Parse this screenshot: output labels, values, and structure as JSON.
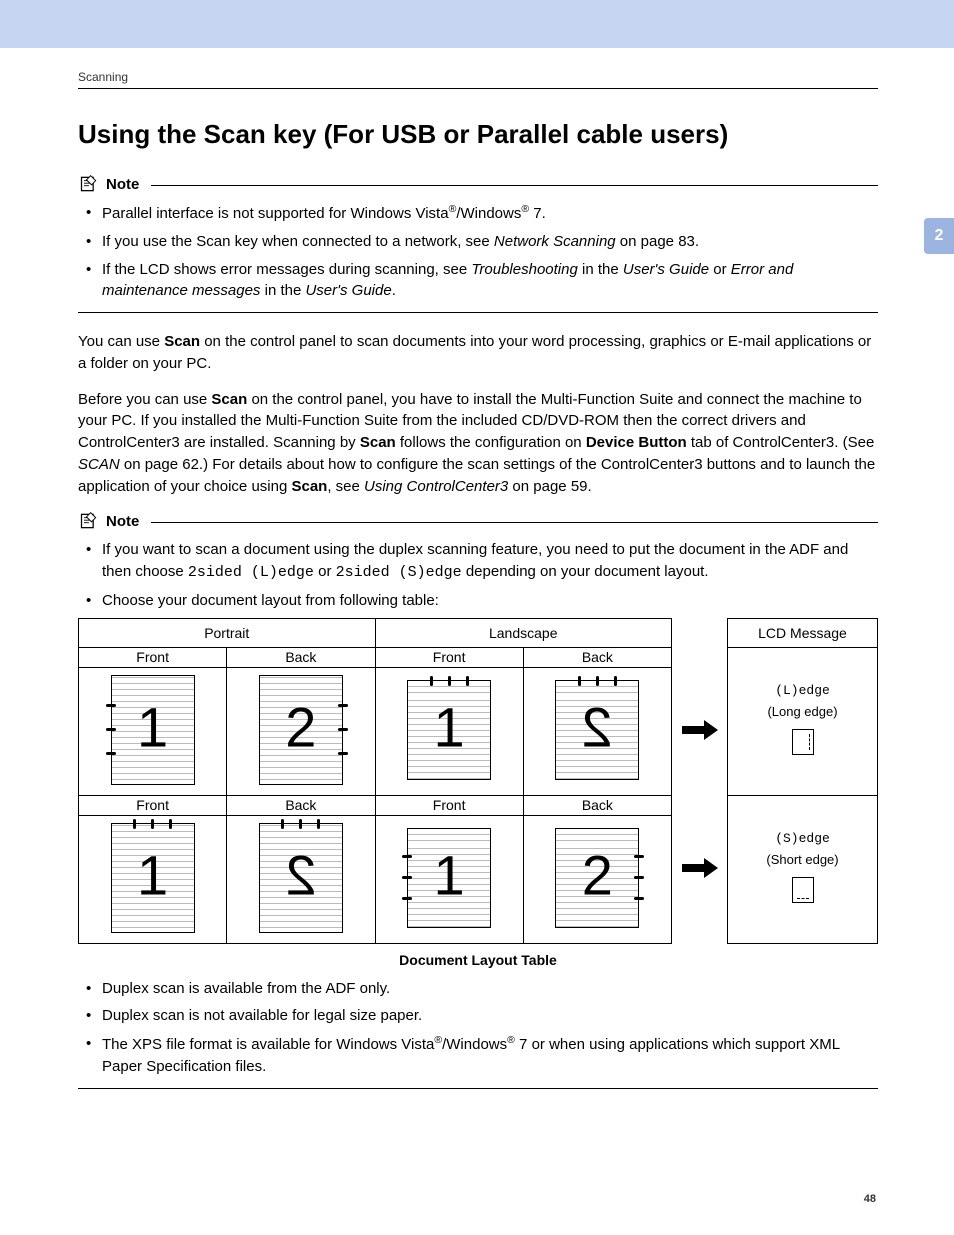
{
  "section_label": "Scanning",
  "title": "Using the Scan key (For USB or Parallel cable users)",
  "chapter_tab": "2",
  "page_number": "48",
  "note1": {
    "label": "Note",
    "bul1_pre": "Parallel interface is not supported for Windows Vista",
    "bul1_mid": "/Windows",
    "bul1_post": " 7.",
    "bul2_pre": "If you use the Scan key when connected to a network, see ",
    "bul2_link": "Network Scanning",
    "bul2_post": " on page 83.",
    "bul3_pre": "If the LCD shows error messages during scanning, see ",
    "bul3_i1": "Troubleshooting",
    "bul3_mid1": " in the ",
    "bul3_i2": "User's Guide",
    "bul3_mid2": " or ",
    "bul3_i3": "Error and maintenance messages",
    "bul3_mid3": " in the ",
    "bul3_i4": "User's Guide",
    "bul3_post": "."
  },
  "para1_a": "You can use ",
  "para1_b": "Scan",
  "para1_c": " on the control panel to scan documents into your word processing, graphics or E-mail applications or a folder on your PC.",
  "para2_a": "Before you can use ",
  "para2_b": "Scan",
  "para2_c": " on the control panel, you have to install the Multi-Function Suite and connect the machine to your PC. If you installed the Multi-Function Suite from the included CD/DVD-ROM then the correct drivers and ControlCenter3 are installed. Scanning by ",
  "para2_d": "Scan",
  "para2_e": " follows the configuration on ",
  "para2_f": "Device Button",
  "para2_g": " tab of ControlCenter3. (See ",
  "para2_h": "SCAN",
  "para2_i": " on page 62.) For details about how to configure the scan settings of the ControlCenter3 buttons and to launch the application of your choice using ",
  "para2_j": "Scan",
  "para2_k": ", see ",
  "para2_l": "Using ControlCenter3",
  "para2_m": " on page 59.",
  "note2": {
    "label": "Note",
    "b1_a": "If you want to scan a document using the duplex scanning feature, you need to put the document in the ADF and then choose ",
    "b1_c1": "2sided (L)edge",
    "b1_b": " or ",
    "b1_c2": "2sided (S)edge",
    "b1_c": " depending on your document layout.",
    "b2": "Choose your document layout from following table:",
    "b3": "Duplex scan is available from the ADF only.",
    "b4": "Duplex scan is not available for legal size paper.",
    "b5_a": "The XPS file format is available for Windows Vista",
    "b5_b": "/Windows",
    "b5_c": " 7 or when using applications which support XML Paper Specification files."
  },
  "table": {
    "caption": "Document Layout Table",
    "h_portrait": "Portrait",
    "h_landscape": "Landscape",
    "h_lcd": "LCD Message",
    "sub_front": "Front",
    "sub_back": "Back",
    "r1_code": "(L)edge",
    "r1_text": "(Long edge)",
    "r2_code": "(S)edge",
    "r2_text": "(Short edge)",
    "n1": "1",
    "n2": "2"
  }
}
